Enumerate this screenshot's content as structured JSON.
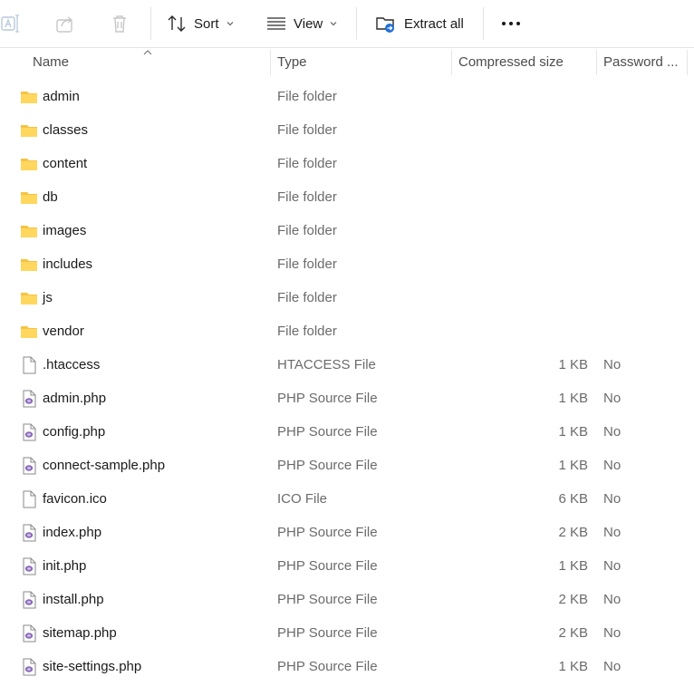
{
  "toolbar": {
    "sort_label": "Sort",
    "view_label": "View",
    "extract_label": "Extract all",
    "icons": [
      "rename-icon",
      "share-icon",
      "delete-icon",
      "sort-icon",
      "view-icon",
      "extract-folder-icon",
      "more-icon"
    ]
  },
  "columns": {
    "name": "Name",
    "type": "Type",
    "compressed_size": "Compressed size",
    "password": "Password ..."
  },
  "files": [
    {
      "name": "admin",
      "type": "File folder",
      "size": "",
      "password": "",
      "kind": "folder"
    },
    {
      "name": "classes",
      "type": "File folder",
      "size": "",
      "password": "",
      "kind": "folder"
    },
    {
      "name": "content",
      "type": "File folder",
      "size": "",
      "password": "",
      "kind": "folder"
    },
    {
      "name": "db",
      "type": "File folder",
      "size": "",
      "password": "",
      "kind": "folder"
    },
    {
      "name": "images",
      "type": "File folder",
      "size": "",
      "password": "",
      "kind": "folder"
    },
    {
      "name": "includes",
      "type": "File folder",
      "size": "",
      "password": "",
      "kind": "folder"
    },
    {
      "name": "js",
      "type": "File folder",
      "size": "",
      "password": "",
      "kind": "folder"
    },
    {
      "name": "vendor",
      "type": "File folder",
      "size": "",
      "password": "",
      "kind": "folder"
    },
    {
      "name": ".htaccess",
      "type": "HTACCESS File",
      "size": "1 KB",
      "password": "No",
      "kind": "file"
    },
    {
      "name": "admin.php",
      "type": "PHP Source File",
      "size": "1 KB",
      "password": "No",
      "kind": "php"
    },
    {
      "name": "config.php",
      "type": "PHP Source File",
      "size": "1 KB",
      "password": "No",
      "kind": "php"
    },
    {
      "name": "connect-sample.php",
      "type": "PHP Source File",
      "size": "1 KB",
      "password": "No",
      "kind": "php"
    },
    {
      "name": "favicon.ico",
      "type": "ICO File",
      "size": "6 KB",
      "password": "No",
      "kind": "file"
    },
    {
      "name": "index.php",
      "type": "PHP Source File",
      "size": "2 KB",
      "password": "No",
      "kind": "php"
    },
    {
      "name": "init.php",
      "type": "PHP Source File",
      "size": "1 KB",
      "password": "No",
      "kind": "php"
    },
    {
      "name": "install.php",
      "type": "PHP Source File",
      "size": "2 KB",
      "password": "No",
      "kind": "php"
    },
    {
      "name": "sitemap.php",
      "type": "PHP Source File",
      "size": "2 KB",
      "password": "No",
      "kind": "php"
    },
    {
      "name": "site-settings.php",
      "type": "PHP Source File",
      "size": "1 KB",
      "password": "No",
      "kind": "php"
    }
  ]
}
